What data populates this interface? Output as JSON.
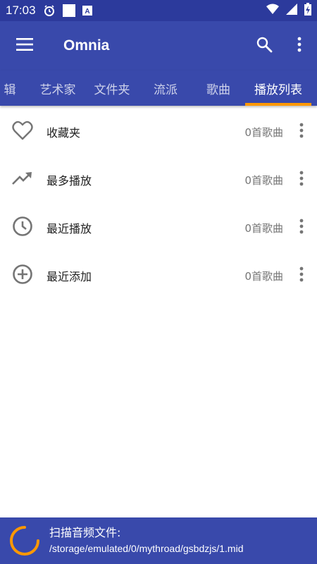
{
  "status_bar": {
    "time": "17:03",
    "icons": [
      "alarm-icon",
      "notification-square-icon",
      "keyboard-a-icon",
      "wifi-icon",
      "signal-icon",
      "battery-charging-icon"
    ]
  },
  "app_bar": {
    "title": "Omnia",
    "icons": [
      "menu-icon",
      "search-icon",
      "more-vert-icon"
    ]
  },
  "tabs": [
    {
      "label": "辑",
      "active": false
    },
    {
      "label": "艺术家",
      "active": false
    },
    {
      "label": "文件夹",
      "active": false
    },
    {
      "label": "流派",
      "active": false
    },
    {
      "label": "歌曲",
      "active": false
    },
    {
      "label": "播放列表",
      "active": true
    }
  ],
  "playlists": [
    {
      "icon": "heart-icon",
      "label": "收藏夹",
      "count": "0首歌曲"
    },
    {
      "icon": "trending-up-icon",
      "label": "最多播放",
      "count": "0首歌曲"
    },
    {
      "icon": "clock-icon",
      "label": "最近播放",
      "count": "0首歌曲"
    },
    {
      "icon": "add-circle-icon",
      "label": "最近添加",
      "count": "0首歌曲"
    }
  ],
  "scan_bar": {
    "title": "扫描音频文件:",
    "path": "/storage/emulated/0/mythroad/gsbdzjs/1.mid"
  },
  "colors": {
    "primary": "#3949ab",
    "status_bar": "#2c3a9c",
    "accent": "#ff9800",
    "icon_gray": "#757575"
  }
}
